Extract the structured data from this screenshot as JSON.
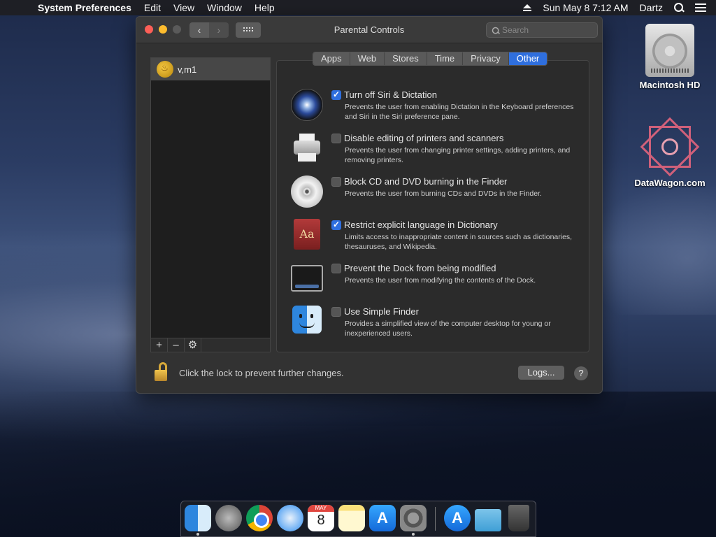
{
  "menubar": {
    "app_name": "System Preferences",
    "items": [
      "Edit",
      "View",
      "Window",
      "Help"
    ],
    "clock": "Sun May 8  7:12 AM",
    "user": "Dartz"
  },
  "window": {
    "title": "Parental Controls",
    "search_placeholder": "Search"
  },
  "sidebar": {
    "users": [
      {
        "name": "v,m1"
      }
    ],
    "add_label": "+",
    "remove_label": "–"
  },
  "tabs": [
    "Apps",
    "Web",
    "Stores",
    "Time",
    "Privacy",
    "Other"
  ],
  "active_tab": "Other",
  "options": [
    {
      "icon": "siri-icon",
      "label": "Turn off Siri & Dictation",
      "checked": true,
      "description": "Prevents the user from enabling Dictation in the Keyboard preferences and Siri in the Siri preference pane."
    },
    {
      "icon": "printer-icon",
      "label": "Disable editing of printers and scanners",
      "checked": false,
      "description": "Prevents the user from changing printer settings, adding printers, and removing printers."
    },
    {
      "icon": "cd-icon",
      "label": "Block CD and DVD burning in the Finder",
      "checked": false,
      "description": "Prevents the user from burning CDs and DVDs in the Finder."
    },
    {
      "icon": "dictionary-icon",
      "label": "Restrict explicit language in Dictionary",
      "checked": true,
      "description": "Limits access to inappropriate content in sources such as dictionaries, thesauruses, and Wikipedia."
    },
    {
      "icon": "dock-icon",
      "label": "Prevent the Dock from being modified",
      "checked": false,
      "description": "Prevents the user from modifying the contents of the Dock."
    },
    {
      "icon": "finder-icon",
      "label": "Use Simple Finder",
      "checked": false,
      "description": "Provides a simplified view of the computer desktop for young or inexperienced users."
    }
  ],
  "footer": {
    "lock_text": "Click the lock to prevent further changes.",
    "logs_label": "Logs...",
    "help_label": "?"
  },
  "desktop": {
    "icons": [
      {
        "label": "Macintosh HD"
      },
      {
        "label": "DataWagon.com"
      }
    ]
  },
  "dock": {
    "calendar_day": "8"
  }
}
